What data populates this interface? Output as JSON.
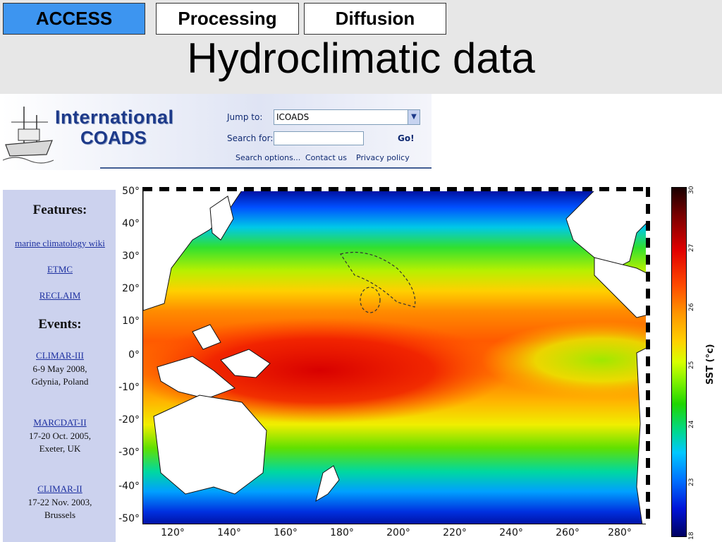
{
  "tabs": [
    {
      "label": "ACCESS",
      "active": true
    },
    {
      "label": "Processing",
      "active": false
    },
    {
      "label": "Diffusion",
      "active": false
    }
  ],
  "slide_title": "Hydroclimatic data",
  "site": {
    "logo_line1": "International",
    "logo_line2": "COADS",
    "jump_label": "Jump to:",
    "jump_value": "ICOADS",
    "search_label": "Search for:",
    "search_value": "",
    "go_label": "Go!",
    "links": [
      "Search options...",
      "Contact us",
      "Privacy policy"
    ]
  },
  "sidebar": {
    "features_heading": "Features:",
    "feature_links": [
      "marine climatology wiki",
      "ETMC",
      "RECLAIM"
    ],
    "events_heading": "Events:",
    "events": [
      {
        "name": "CLIMAR-III",
        "line1": "6-9 May 2008,",
        "line2": "Gdynia, Poland"
      },
      {
        "name": "MARCDAT-II",
        "line1": "17-20 Oct. 2005,",
        "line2": "Exeter, UK"
      },
      {
        "name": "CLIMAR-II",
        "line1": "17-22 Nov. 2003,",
        "line2": "Brussels"
      }
    ]
  },
  "map": {
    "lat_labels": [
      "50°",
      "40°",
      "30°",
      "20°",
      "10°",
      "0°",
      "-10°",
      "-20°",
      "-30°",
      "-40°",
      "-50°"
    ],
    "lon_labels": [
      "120°",
      "140°",
      "160°",
      "180°",
      "200°",
      "220°",
      "240°",
      "260°",
      "280°"
    ],
    "colorbar_ticks": [
      "30",
      "27",
      "26",
      "25",
      "24",
      "23",
      "18"
    ],
    "colorbar_label": "SST (°c)",
    "colors": {
      "warm": "#e60000",
      "mid": "#ffb000",
      "cool": "#00d000",
      "cold": "#0020c8"
    }
  }
}
